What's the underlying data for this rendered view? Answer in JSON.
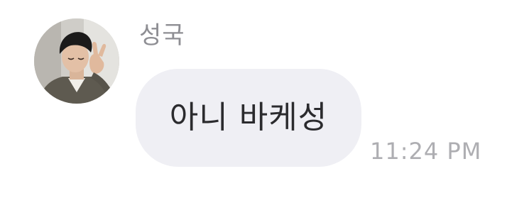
{
  "message": {
    "sender_name": "성국",
    "text": "아니 바케성",
    "timestamp": "11:24 PM",
    "avatar_icon": "profile-photo"
  },
  "colors": {
    "background": "#ffffff",
    "bubble": "#efeff4",
    "text": "#2b2b2e",
    "sender_name": "#8e8e93",
    "timestamp": "#aeaeb2"
  }
}
